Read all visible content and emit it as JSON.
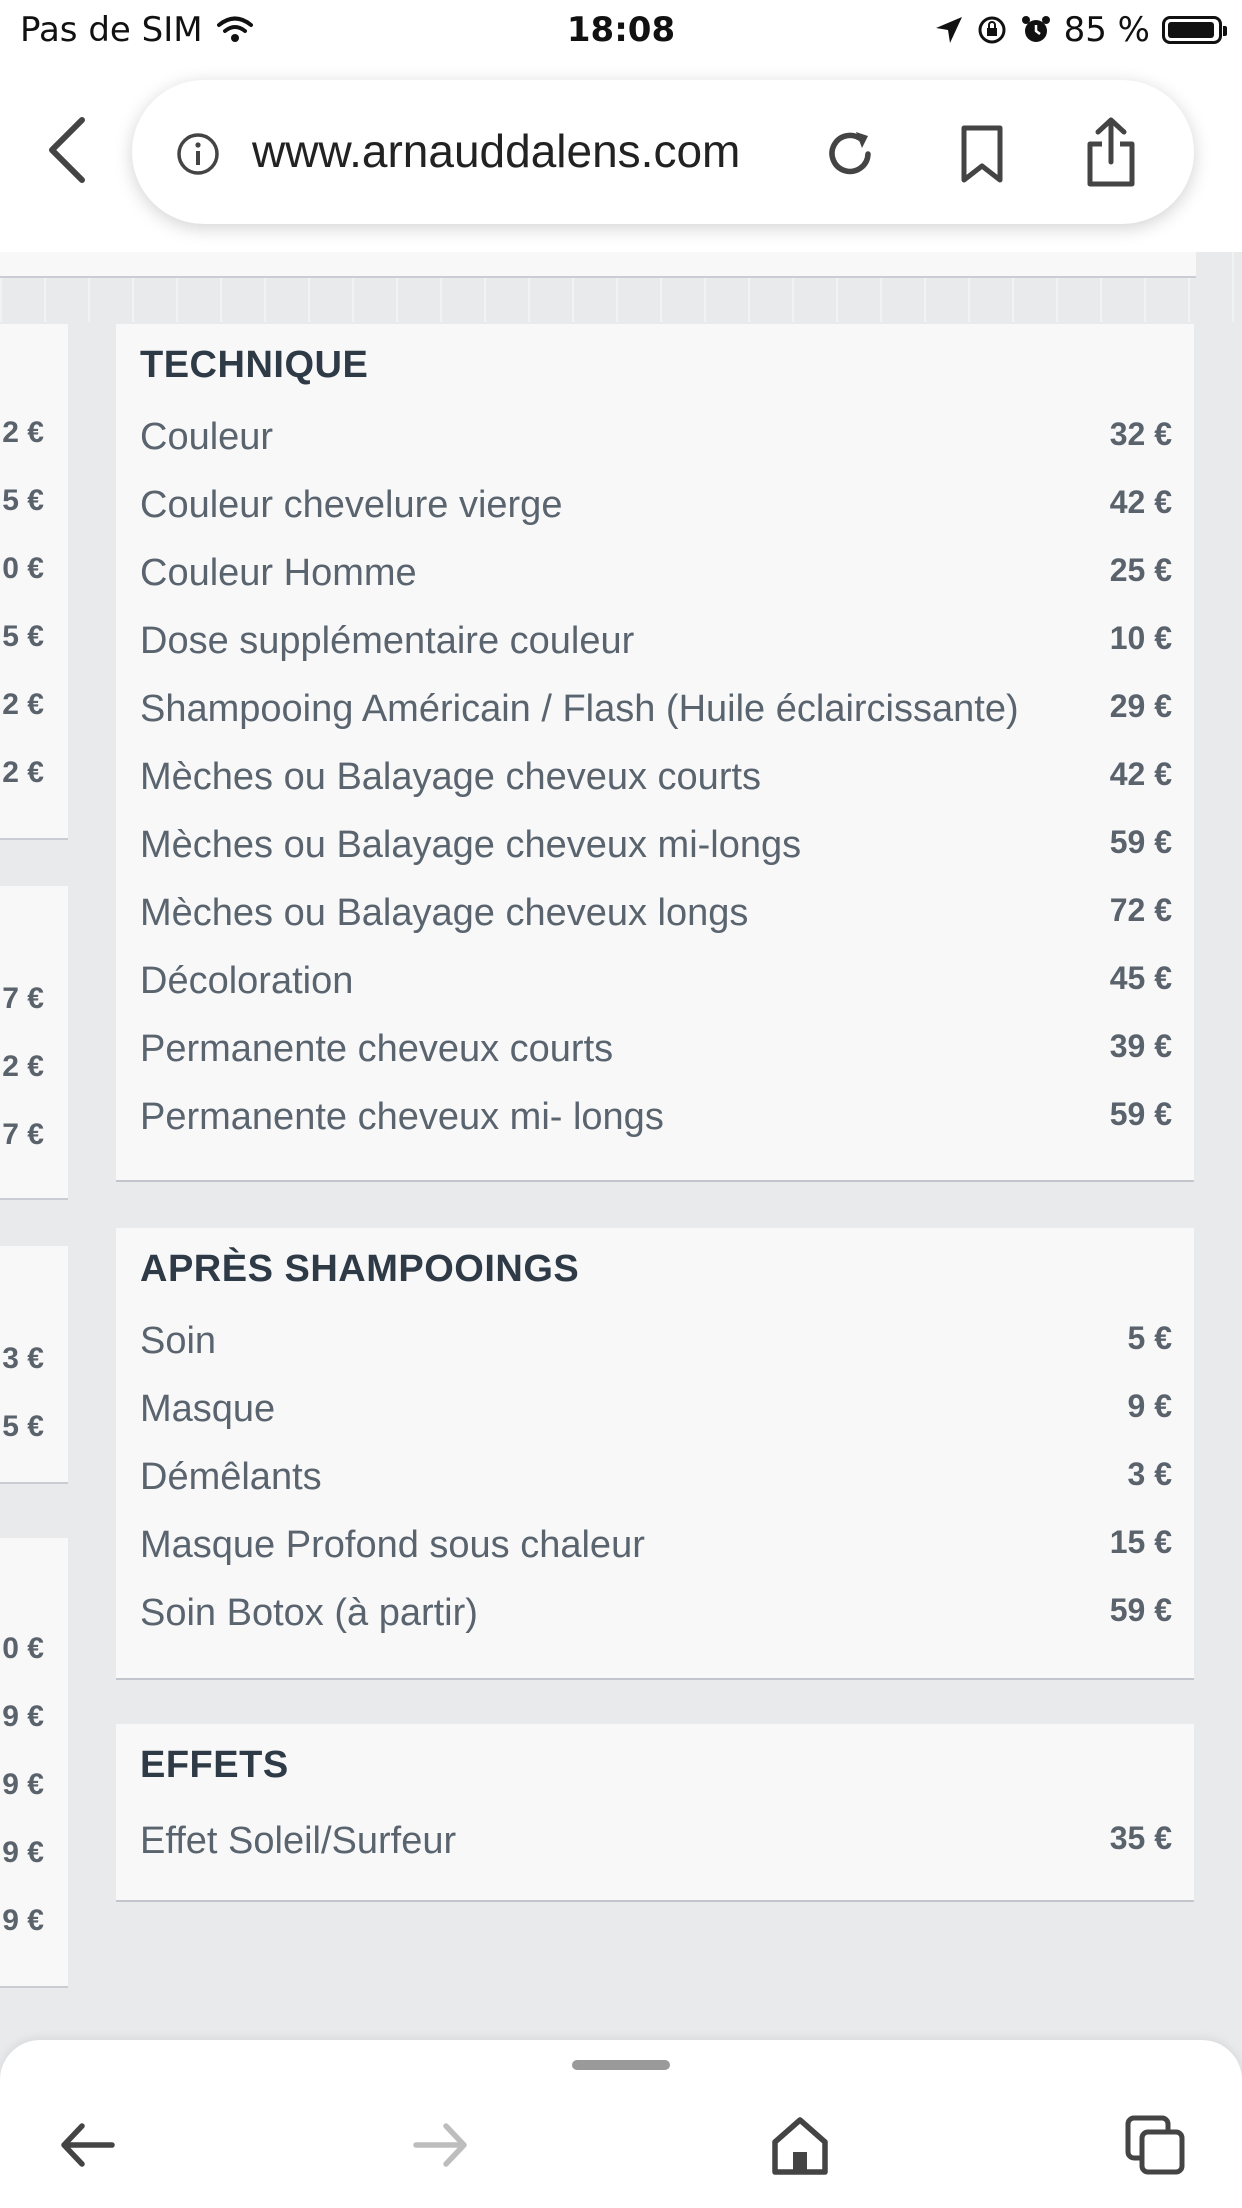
{
  "status_bar": {
    "carrier": "Pas de SIM",
    "time": "18:08",
    "battery": "85 %",
    "icons": [
      "wifi-icon",
      "location-arrow-icon",
      "orientation-lock-icon",
      "alarm-icon",
      "battery-icon"
    ]
  },
  "browser": {
    "url": "www.arnauddalens.com",
    "icons": [
      "back-chevron-icon",
      "info-icon",
      "reload-icon",
      "bookmark-icon",
      "share-icon"
    ]
  },
  "left_column": {
    "group1": [
      "2 €",
      "5 €",
      "0 €",
      "5 €",
      "2 €",
      "2 €"
    ],
    "group2": [
      "7 €",
      "2 €",
      "7 €"
    ],
    "group3": [
      "3 €",
      "5 €"
    ],
    "group4": [
      "0 €",
      "9 €",
      "9 €",
      "9 €",
      "9 €"
    ]
  },
  "sections": [
    {
      "title": "TECHNIQUE",
      "items": [
        {
          "name": "Couleur",
          "price": "32 €"
        },
        {
          "name": "Couleur chevelure vierge",
          "price": "42 €"
        },
        {
          "name": "Couleur Homme",
          "price": "25 €"
        },
        {
          "name": "Dose supplémentaire couleur",
          "price": "10 €"
        },
        {
          "name": "Shampooing Américain / Flash (Huile éclaircissante)",
          "price": "29 €"
        },
        {
          "name": "Mèches ou Balayage cheveux courts",
          "price": "42 €"
        },
        {
          "name": "Mèches ou Balayage cheveux mi-longs",
          "price": "59 €"
        },
        {
          "name": "Mèches ou Balayage cheveux longs",
          "price": "72 €"
        },
        {
          "name": "Décoloration",
          "price": "45 €"
        },
        {
          "name": "Permanente cheveux courts",
          "price": "39 €"
        },
        {
          "name": "Permanente cheveux mi- longs",
          "price": "59 €"
        }
      ]
    },
    {
      "title": "APRÈS SHAMPOOINGS",
      "items": [
        {
          "name": "Soin",
          "price": "5 €"
        },
        {
          "name": "Masque",
          "price": "9 €"
        },
        {
          "name": "Démêlants",
          "price": "3 €"
        },
        {
          "name": "Masque Profond sous chaleur",
          "price": "15 €"
        },
        {
          "name": "Soin Botox (à partir)",
          "price": "59 €"
        }
      ]
    },
    {
      "title": "EFFETS",
      "items": [
        {
          "name": "Effet Soleil/Surfeur",
          "price": "35 €"
        }
      ]
    }
  ],
  "toolbar": {
    "icons": [
      "back-arrow-icon",
      "forward-arrow-icon",
      "home-icon",
      "tabs-icon"
    ]
  },
  "colors": {
    "page_bg": "#e9eaec",
    "card_bg": "#f8f8f9",
    "title": "#2e3a46",
    "text": "#5a646e"
  }
}
